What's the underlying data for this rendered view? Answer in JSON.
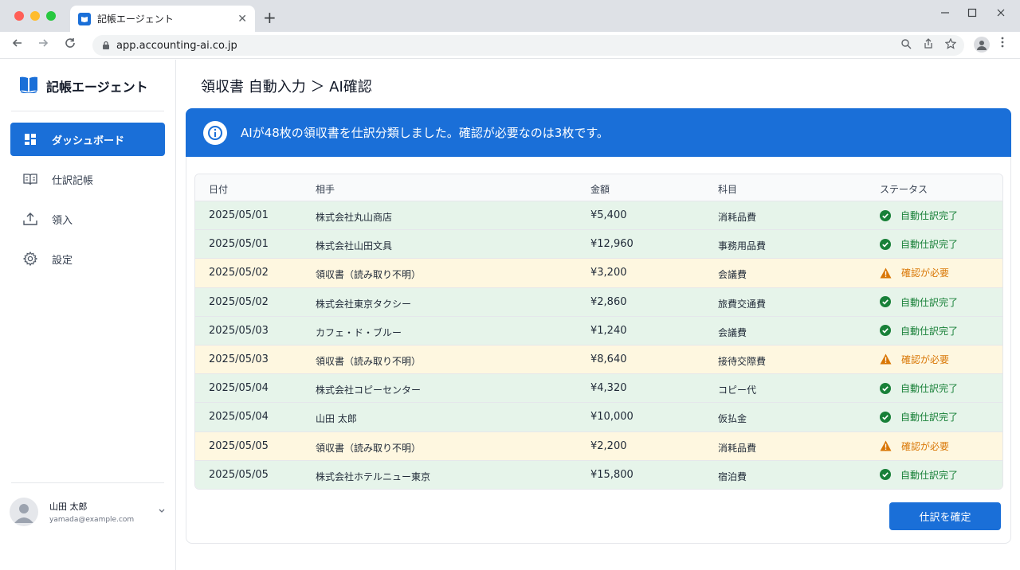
{
  "browser": {
    "tab_title": "記帳エージェント",
    "url": "app.accounting-ai.co.jp",
    "new_tab_glyph": "+",
    "tab_close_glyph": "✕"
  },
  "sidebar": {
    "brand": "記帳エージェント",
    "items": [
      {
        "label": "ダッシュボード",
        "icon": "dashboard-icon",
        "active": true
      },
      {
        "label": "仕訳記帳",
        "icon": "book-icon",
        "active": false
      },
      {
        "label": "領入",
        "icon": "upload-icon",
        "active": false
      },
      {
        "label": "設定",
        "icon": "gear-icon",
        "active": false
      }
    ],
    "user": {
      "name": "山田 太郎",
      "email": "yamada@example.com"
    }
  },
  "main": {
    "breadcrumb": "領収書 自動入力 ＞ AI確認",
    "banner": "AIが48枚の領収書を仕訳分類しました。確認が必要なのは3枚です。",
    "columns": [
      "日付",
      "相手",
      "金額",
      "科目",
      "ステータス"
    ],
    "rows": [
      {
        "date": "2025/05/01",
        "party": "株式会社丸山商店",
        "amount": "¥5,400",
        "account": "消耗品費",
        "status": "自動仕訳完了",
        "state": "ok"
      },
      {
        "date": "2025/05/01",
        "party": "株式会社山田文具",
        "amount": "¥12,960",
        "account": "事務用品費",
        "status": "自動仕訳完了",
        "state": "ok"
      },
      {
        "date": "2025/05/02",
        "party": "領収書（読み取り不明）",
        "amount": "¥3,200",
        "account": "会議費",
        "status": "確認が必要",
        "state": "warn"
      },
      {
        "date": "2025/05/02",
        "party": "株式会社東京タクシー",
        "amount": "¥2,860",
        "account": "旅費交通費",
        "status": "自動仕訳完了",
        "state": "ok"
      },
      {
        "date": "2025/05/03",
        "party": "カフェ・ド・ブルー",
        "amount": "¥1,240",
        "account": "会議費",
        "status": "自動仕訳完了",
        "state": "ok"
      },
      {
        "date": "2025/05/03",
        "party": "領収書（読み取り不明）",
        "amount": "¥8,640",
        "account": "接待交際費",
        "status": "確認が必要",
        "state": "warn"
      },
      {
        "date": "2025/05/04",
        "party": "株式会社コピーセンター",
        "amount": "¥4,320",
        "account": "コピー代",
        "status": "自動仕訳完了",
        "state": "ok"
      },
      {
        "date": "2025/05/04",
        "party": "山田 太郎",
        "amount": "¥10,000",
        "account": "仮払金",
        "status": "自動仕訳完了",
        "state": "ok"
      },
      {
        "date": "2025/05/05",
        "party": "領収書（読み取り不明）",
        "amount": "¥2,200",
        "account": "消耗品費",
        "status": "確認が必要",
        "state": "warn"
      },
      {
        "date": "2025/05/05",
        "party": "株式会社ホテルニュー東京",
        "amount": "¥15,800",
        "account": "宿泊費",
        "status": "自動仕訳完了",
        "state": "ok"
      }
    ],
    "confirm_button": "仕訳を確定"
  },
  "colors": {
    "accent": "#1a6fd8",
    "ok_bg": "#e6f4ea",
    "warn_bg": "#fef7e0",
    "ok_text": "#188038",
    "warn_text": "#d97706"
  }
}
